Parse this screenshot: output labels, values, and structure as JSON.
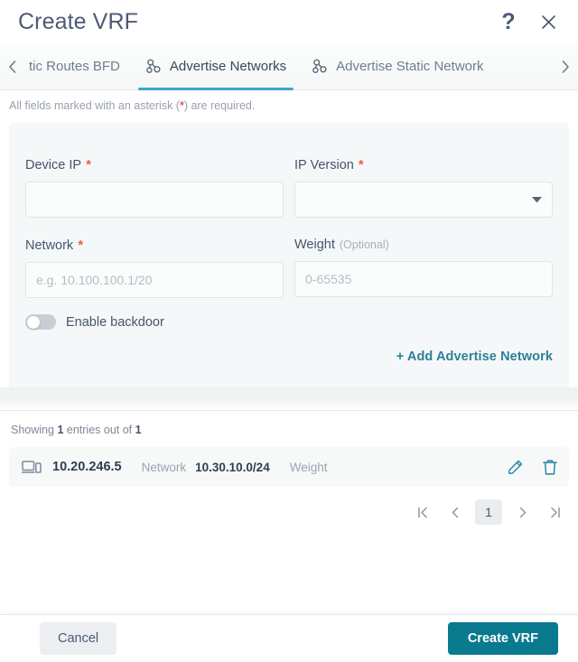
{
  "header": {
    "title": "Create VRF",
    "help_icon": "question-mark-icon",
    "close_icon": "close-icon"
  },
  "tabs": {
    "prev_icon": "chevron-left-icon",
    "next_icon": "chevron-right-icon",
    "items": [
      {
        "label": "tic Routes BFD",
        "icon": "",
        "active": false
      },
      {
        "label": "Advertise Networks",
        "icon": "network-nodes-icon",
        "active": true
      },
      {
        "label": "Advertise Static Network",
        "icon": "network-nodes-icon",
        "active": false
      }
    ]
  },
  "required_note": {
    "prefix": "All fields marked with an asterisk (",
    "asterisk": "*",
    "suffix": ") are required."
  },
  "form": {
    "device_ip": {
      "label": "Device IP",
      "required_mark": "*",
      "value": "",
      "placeholder": ""
    },
    "ip_version": {
      "label": "IP Version",
      "required_mark": "*",
      "value": "",
      "placeholder": "",
      "caret_icon": "chevron-down-icon"
    },
    "network": {
      "label": "Network",
      "required_mark": "*",
      "value": "",
      "placeholder": "e.g. 10.100.100.1/20"
    },
    "weight": {
      "label": "Weight",
      "optional_tag": "(Optional)",
      "value": "",
      "placeholder": "0-65535"
    },
    "enable_backdoor": {
      "label": "Enable backdoor",
      "state": "off"
    },
    "add_link": "+ Add Advertise Network"
  },
  "table": {
    "showing_prefix": "Showing",
    "showing_count": "1",
    "showing_middle": "entries out of",
    "showing_total": "1",
    "rows": [
      {
        "device_icon": "device-monitor-icon",
        "ip": "10.20.246.5",
        "network_key": "Network",
        "network_value": "10.30.10.0/24",
        "weight_key": "Weight",
        "weight_value": "",
        "edit_icon": "pencil-edit-icon",
        "delete_icon": "trash-delete-icon"
      }
    ]
  },
  "pagination": {
    "first_icon": "first-page-icon",
    "prev_icon": "prev-page-icon",
    "current_page": "1",
    "next_icon": "next-page-icon",
    "last_icon": "last-page-icon"
  },
  "footer": {
    "cancel_label": "Cancel",
    "submit_label": "Create VRF"
  },
  "colors": {
    "accent_teal": "#09798e",
    "tab_underline": "#3aa7c4",
    "link": "#2e7f98",
    "required_asterisk": "#e8604c",
    "title_text": "#4c5a74",
    "card_bg": "#f5f8f8"
  }
}
